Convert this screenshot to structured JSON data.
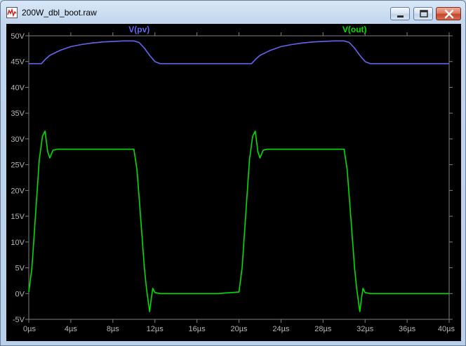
{
  "window": {
    "title": "200W_dbl_boot.raw",
    "icon": "waveform-icon",
    "controls": [
      "minimize-icon",
      "maximize-icon",
      "close-icon"
    ]
  },
  "colors": {
    "plot_background": "#000000",
    "axis": "#808080",
    "tick_text": "#b4b4b4",
    "v_pv": "#6464f0",
    "v_out": "#00e000"
  },
  "chart_data": {
    "type": "line",
    "title": "",
    "xlabel": "",
    "ylabel": "",
    "xlim": [
      0,
      40
    ],
    "ylim": [
      -5,
      50
    ],
    "x_unit": "µs",
    "y_unit": "V",
    "x_ticks": [
      "0µs",
      "4µs",
      "8µs",
      "12µs",
      "16µs",
      "20µs",
      "24µs",
      "28µs",
      "32µs",
      "36µs",
      "40µs"
    ],
    "y_ticks": [
      "50V",
      "45V",
      "40V",
      "35V",
      "30V",
      "25V",
      "20V",
      "15V",
      "10V",
      "5V",
      "0V",
      "-5V"
    ],
    "grid": false,
    "legend": "top",
    "series": [
      {
        "name": "V(pv)",
        "color": "#6464f0",
        "x": [
          0,
          1.2,
          1.6,
          2,
          3,
          4,
          5,
          6,
          7,
          8,
          9,
          10,
          10.5,
          11,
          11.5,
          12,
          12.5,
          14,
          16,
          18,
          20,
          21.2,
          21.6,
          22,
          23,
          24,
          25,
          26,
          27,
          28,
          29,
          30,
          30.5,
          31,
          31.5,
          32,
          32.5,
          34,
          36,
          38,
          40
        ],
        "y": [
          44.6,
          44.6,
          45.5,
          46.2,
          47.2,
          47.9,
          48.3,
          48.6,
          48.8,
          48.9,
          49.0,
          49.0,
          48.7,
          47.6,
          46.2,
          45.0,
          44.6,
          44.6,
          44.6,
          44.6,
          44.6,
          44.6,
          45.5,
          46.2,
          47.2,
          47.9,
          48.3,
          48.6,
          48.8,
          48.9,
          49.0,
          49.0,
          48.7,
          47.6,
          46.2,
          45.0,
          44.6,
          44.6,
          44.6,
          44.6,
          44.6
        ]
      },
      {
        "name": "V(out)",
        "color": "#00e000",
        "x": [
          0,
          0.3,
          1.0,
          1.3,
          1.55,
          1.8,
          2.0,
          2.3,
          2.7,
          4,
          8,
          10.0,
          10.3,
          10.6,
          11.0,
          11.2,
          11.5,
          11.65,
          11.8,
          12.0,
          12.5,
          13,
          14,
          16,
          18,
          20.0,
          20.3,
          21.0,
          21.3,
          21.55,
          21.8,
          22.0,
          22.3,
          22.7,
          24,
          28,
          30.0,
          30.3,
          30.6,
          31.0,
          31.2,
          31.5,
          31.65,
          31.8,
          32.0,
          32.5,
          33,
          34,
          36,
          38,
          40
        ],
        "y": [
          0.3,
          5,
          26,
          30.5,
          31.5,
          27.5,
          26.3,
          27.8,
          28,
          28,
          28,
          28,
          24,
          16,
          5,
          1,
          -3.5,
          -1,
          1,
          0.2,
          0,
          0,
          0,
          0,
          0,
          0.3,
          5,
          26,
          30.5,
          31.5,
          27.5,
          26.3,
          27.8,
          28,
          28,
          28,
          28,
          24,
          16,
          5,
          1,
          -3.5,
          -1,
          1,
          0.2,
          0,
          0,
          0,
          0,
          0,
          0
        ]
      }
    ]
  }
}
